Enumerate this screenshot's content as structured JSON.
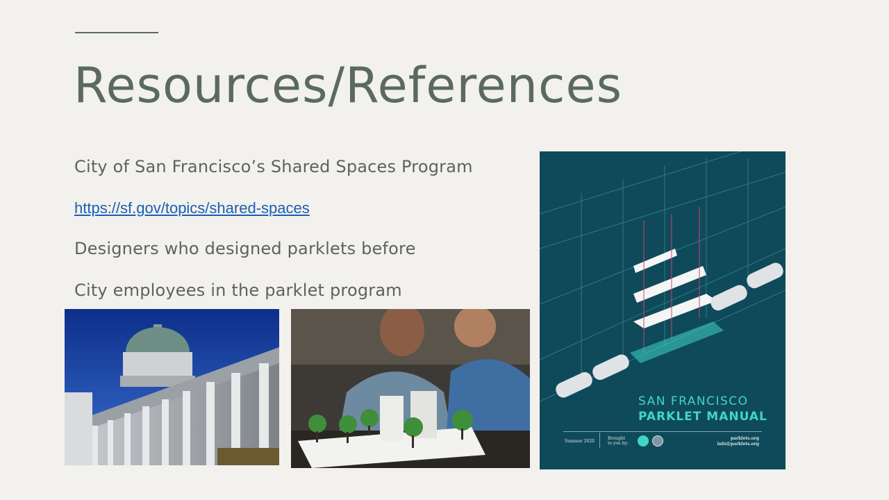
{
  "slide": {
    "title": "Resources/References",
    "lines": {
      "program": "City of San Francisco’s Shared Spaces Program",
      "link": "https://sf.gov/topics/shared-spaces",
      "designers": "Designers who designed parklets before",
      "employees": "City employees in the parklet program"
    }
  },
  "manual_cover": {
    "title_line1": "SAN FRANCISCO",
    "title_line2": "PARKLET MANUAL",
    "date": "Summer 2020",
    "brought_by": "Brought to you by:",
    "site": "parklets.org",
    "email": "info@parklets.org"
  },
  "colors": {
    "background": "#f2f1ed",
    "title": "#5a6b5e",
    "body_text": "#5e625e",
    "link": "#1a5fb4",
    "cover_bg": "#0f4a5a",
    "cover_accent": "#3fd6c6"
  }
}
